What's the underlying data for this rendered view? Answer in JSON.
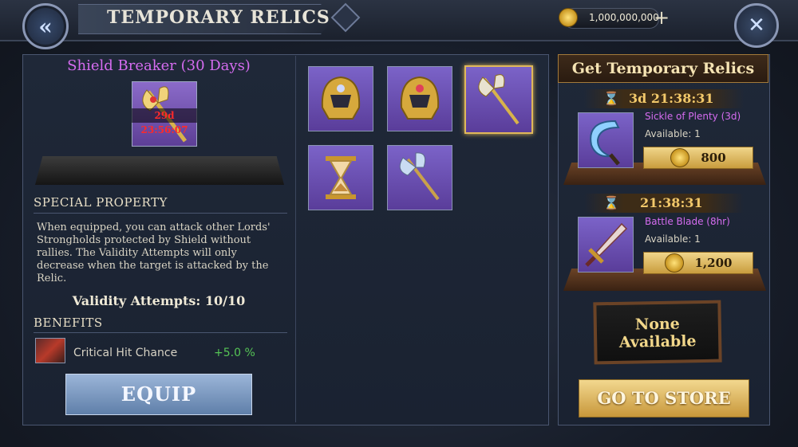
{
  "header": {
    "title": "TEMPORARY RELICS",
    "gold_amount": "1,000,000,000",
    "back_icon": "double-chevron-left-icon",
    "close_icon": "crossed-swords-close-icon",
    "add_icon": "plus-icon"
  },
  "relic_detail": {
    "name": "Shield Breaker (30 Days)",
    "timer": "29d 23:56:07",
    "special_property_heading": "SPECIAL PROPERTY",
    "description": "When equipped, you can attack other Lords' Strongholds protected by Shield without rallies. The Validity Attempts will only decrease when the target is attacked by the Relic.",
    "validity": "Validity Attempts: 10/10",
    "benefits_heading": "BENEFITS",
    "benefit_label": "Critical Hit Chance",
    "benefit_value": "+5.0 %",
    "equip_label": "EQUIP"
  },
  "inventory": [
    {
      "icon": "golden-helmet-icon"
    },
    {
      "icon": "golden-helmet-icon"
    },
    {
      "icon": "golden-axe-icon",
      "selected": true
    },
    {
      "icon": "hourglass-icon"
    },
    {
      "icon": "battle-axe-icon"
    }
  ],
  "shop": {
    "heading": "Get Temporary Relics",
    "offers": [
      {
        "timer": "3d 21:38:31",
        "name": "Sickle of Plenty (3d)",
        "available": "Available: 1",
        "price": "800",
        "icon": "sickle-icon"
      },
      {
        "timer": "21:38:31",
        "name": "Battle Blade (8hr)",
        "available": "Available: 1",
        "price": "1,200",
        "icon": "sword-icon"
      }
    ],
    "none_line1": "None",
    "none_line2": "Available",
    "store_label": "GO TO STORE"
  },
  "colors": {
    "accent_purple": "#d56cf0",
    "gold": "#e0b85a",
    "benefit_green": "#55c455"
  }
}
